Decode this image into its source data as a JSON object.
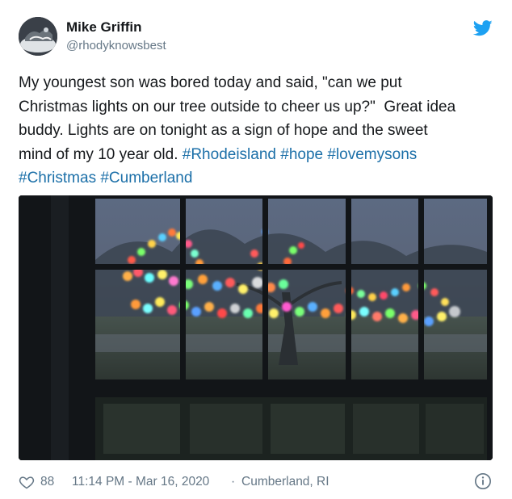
{
  "author": {
    "name": "Mike Griffin",
    "handle": "@rhodyknowsbest"
  },
  "icons": {
    "avatar": "profile-photo",
    "brand": "twitter-bird-icon",
    "like": "heart-icon",
    "info": "info-icon",
    "brand_color": "#1da1f2",
    "hashtag_color": "#1b6fa8"
  },
  "tweet": {
    "line1": "My youngest son was bored today and said, \"can we put",
    "line2": "Christmas lights on our tree outside to cheer us up?\"  Great idea",
    "line3": "buddy. Lights are on tonight as a sign of hope and the sweet",
    "line4_text": "mind of my 10 year old. ",
    "hashtags": [
      "#Rhodeisland",
      "#hope",
      "#lovemysons",
      "#Christmas",
      "#Cumberland"
    ]
  },
  "media": {
    "description_icon": "photo"
  },
  "footer": {
    "likes": "88",
    "timestamp": "11:14 PM - Mar 16, 2020",
    "separator": "·",
    "location": "Cumberland, RI"
  }
}
